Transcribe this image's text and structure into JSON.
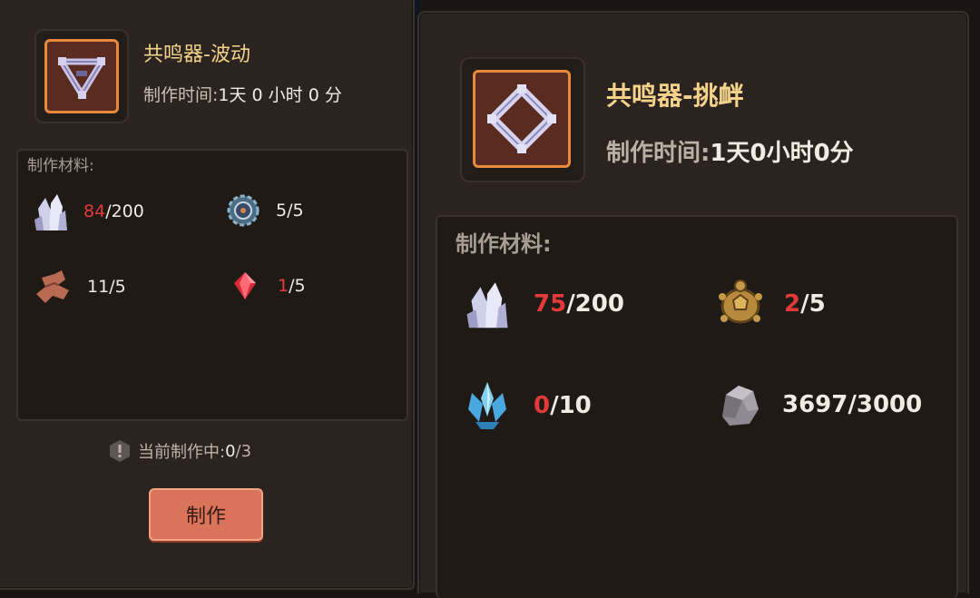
{
  "left": {
    "item_name": "共鸣器-波动",
    "time_label": "制作时间:",
    "time_value": "1天 0 小时 0 分",
    "materials_title": "制作材料:",
    "materials": [
      {
        "icon": "crystal-cluster-icon",
        "have": "84",
        "need": "/200",
        "insufficient": true
      },
      {
        "icon": "gear-core-icon",
        "have": "5",
        "need": "/5",
        "insufficient": false
      },
      {
        "icon": "leather-scrap-icon",
        "have": "11",
        "need": "/5",
        "insufficient": false
      },
      {
        "icon": "red-gem-icon",
        "have": "1",
        "need": "/5",
        "insufficient": true
      }
    ],
    "status_label": "当前制作中:",
    "status_current": "0",
    "status_max": "/3",
    "craft_button": "制作"
  },
  "right": {
    "item_name": "共鸣器-挑衅",
    "time_label": "制作时间:",
    "time_value": "1天0小时0分",
    "materials_title": "制作材料:",
    "materials": [
      {
        "icon": "crystal-cluster-icon",
        "have": "75",
        "need": "/200",
        "insufficient": true
      },
      {
        "icon": "turtle-shell-icon",
        "have": "2",
        "need": "/5",
        "insufficient": true
      },
      {
        "icon": "blue-crystal-icon",
        "have": "0",
        "need": "/10",
        "insufficient": true
      },
      {
        "icon": "stone-ore-icon",
        "have": "3697",
        "need": "/3000",
        "insufficient": false
      }
    ]
  },
  "colors": {
    "title": "#f3d28a",
    "insufficient": "#e23a3a",
    "button": "#d9745a",
    "frame": "#e8893d"
  }
}
